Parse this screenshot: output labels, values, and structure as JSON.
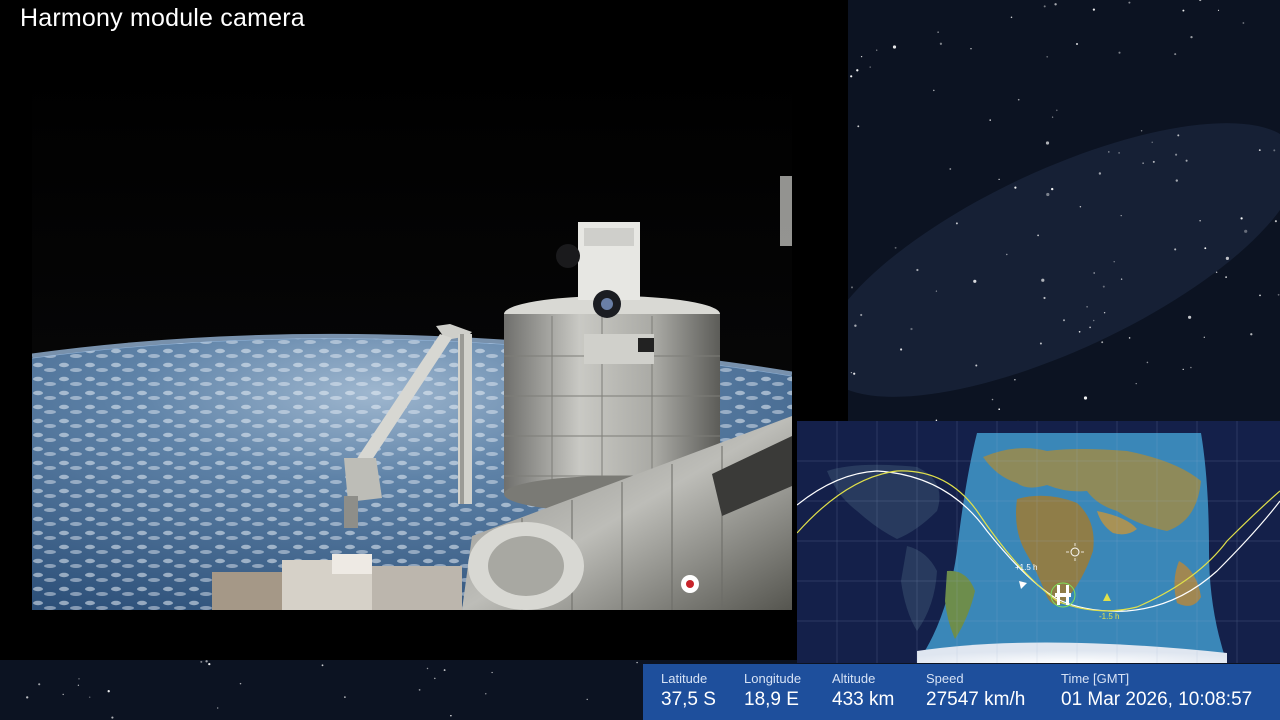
{
  "camera": {
    "title": "Harmony module camera"
  },
  "tracker": {
    "labels": [
      "+1.5 h",
      "-1.5 h"
    ]
  },
  "telemetry": {
    "latitude": {
      "label": "Latitude",
      "value": "37,5 S"
    },
    "longitude": {
      "label": "Longitude",
      "value": "18,9 E"
    },
    "altitude": {
      "label": "Altitude",
      "value": "433 km"
    },
    "speed": {
      "label": "Speed",
      "value": "27547 km/h"
    },
    "time": {
      "label": "Time [GMT]",
      "value": "01 Mar 2026, 10:08:57"
    }
  },
  "colors": {
    "telemetry_bar": "#1e4f9c",
    "ocean_day": "#3a87b8",
    "night_side": "#14204a",
    "orbit_future": "#ffffff",
    "orbit_past": "#e0e04a"
  }
}
